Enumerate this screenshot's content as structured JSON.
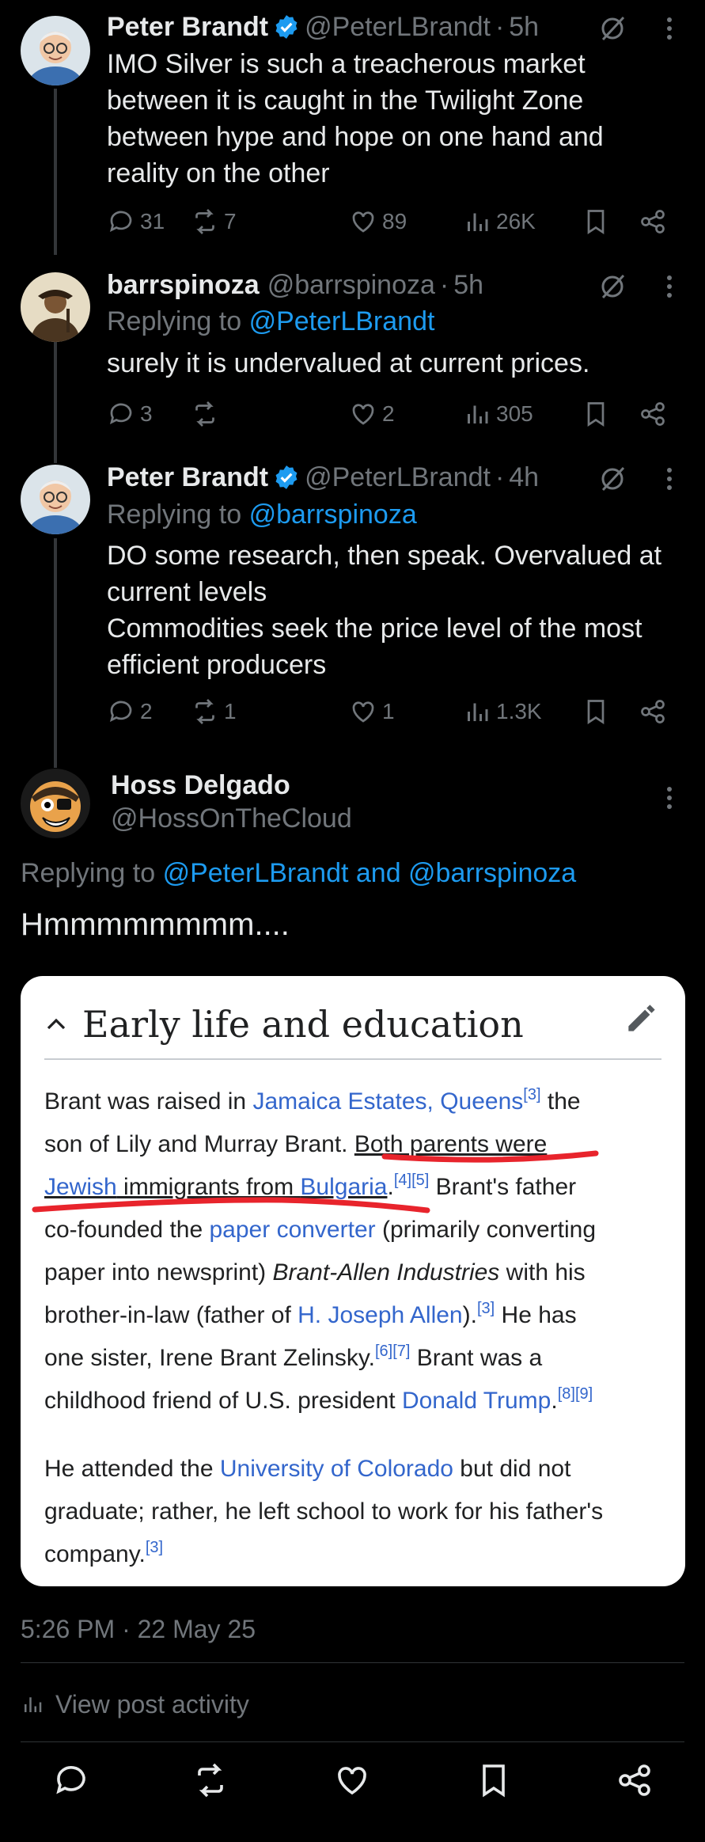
{
  "thread": [
    {
      "name": "Peter Brandt",
      "verified": true,
      "handle": "@PeterLBrandt",
      "time": "5h",
      "replying_to": null,
      "text_lines": [
        "IMO Silver is such a treacherous market",
        "between it is caught in the Twilight Zone",
        "between hype and hope on one hand and",
        "reality on the other"
      ],
      "replies": "31",
      "reposts": "7",
      "likes": "89",
      "views": "26K"
    },
    {
      "name": "barrspinoza",
      "verified": false,
      "handle": "@barrspinoza",
      "time": "5h",
      "replying_prefix": "Replying to",
      "replying_to": "@PeterLBrandt",
      "text_lines": [
        "surely it is undervalued at current prices."
      ],
      "replies": "3",
      "reposts": "",
      "likes": "2",
      "views": "305"
    },
    {
      "name": "Peter Brandt",
      "verified": true,
      "handle": "@PeterLBrandt",
      "time": "4h",
      "replying_prefix": "Replying to",
      "replying_to": "@barrspinoza",
      "text_lines": [
        "DO some research, then speak. Overvalued at",
        "current levels",
        "Commodities seek the price level of the most",
        "efficient producers"
      ],
      "replies": "2",
      "reposts": "1",
      "likes": "1",
      "views": "1.3K"
    }
  ],
  "main": {
    "name": "Hoss Delgado",
    "handle": "@HossOnTheCloud",
    "replying_prefix": "Replying to",
    "replying_to": "@PeterLBrandt and @barrspinoza",
    "text": "Hmmmmmmmm....",
    "timestamp": "5:26 PM · 22 May 25",
    "view_activity": "View post activity"
  },
  "wiki_card": {
    "title": "Early life and education",
    "p1": [
      [
        "Brant was raised in ",
        "Jamaica Estates, Queens",
        "[3]",
        " the"
      ],
      [
        "son of Lily and Murray Brant. ",
        "Both parents were"
      ],
      [
        "Jewish",
        " immigrants from ",
        "Bulgaria",
        ".",
        "[4][5]",
        " Brant's father"
      ],
      [
        "co-founded the ",
        "paper converter",
        " (primarily converting"
      ],
      [
        "paper into newsprint) ",
        "Brant-Allen Industries",
        " with his"
      ],
      [
        "brother-in-law (father of ",
        "H. Joseph Allen",
        ").",
        "[3]",
        " He has"
      ],
      [
        "one sister, Irene Brant Zelinsky.",
        "[6][7]",
        " Brant was a"
      ],
      [
        "childhood friend of U.S. president ",
        "Donald Trump",
        ".",
        "[8][9]"
      ]
    ],
    "p2": [
      [
        "He attended the ",
        "University of Colorado",
        " but did not"
      ],
      [
        "graduate; rather, he left school to work for his father's"
      ],
      [
        "company.",
        "[3]"
      ]
    ]
  },
  "colors": {
    "background": "#000000",
    "text": "#e7e9ea",
    "muted": "#71767b",
    "link": "#1d9bf0",
    "verified": "#1d9bf0",
    "wiki_link": "#3366cc",
    "annotation": "#e8242c"
  },
  "icons": [
    "verified-badge-icon",
    "grok-icon",
    "more-icon",
    "reply-icon",
    "repost-icon",
    "like-icon",
    "views-icon",
    "bookmark-icon",
    "share-icon",
    "chevron-up-icon",
    "pencil-icon"
  ]
}
